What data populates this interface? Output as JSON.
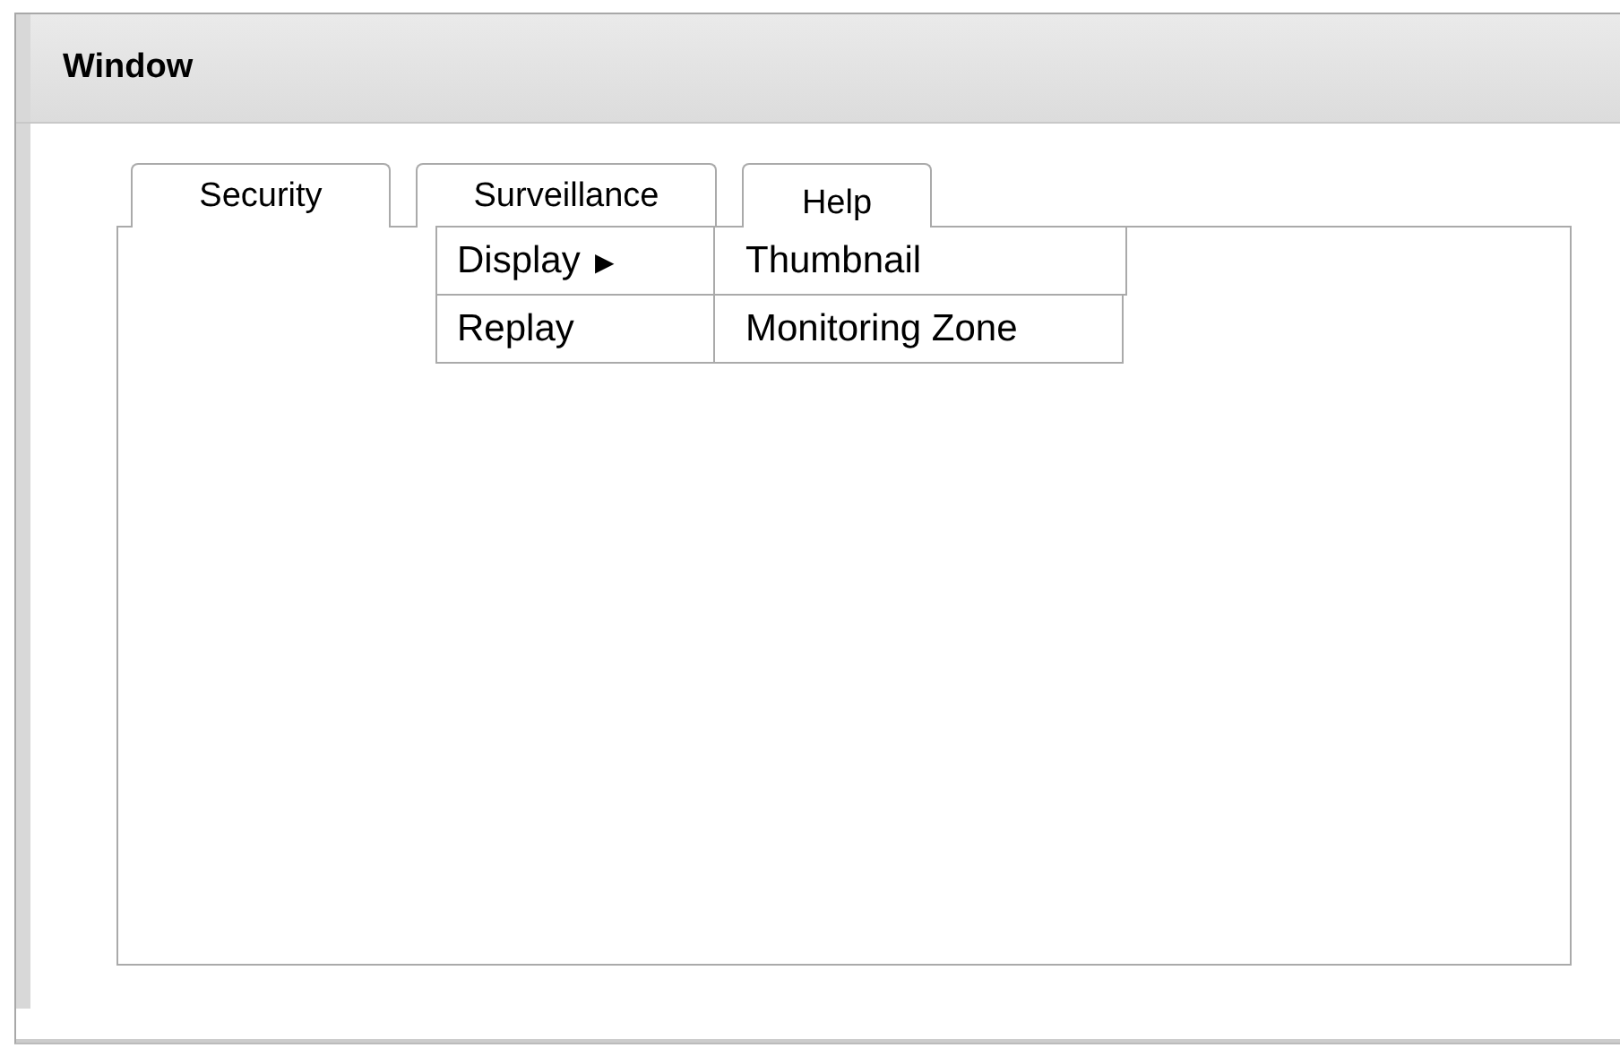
{
  "window": {
    "title": "Window"
  },
  "tabs": [
    {
      "label": "Security"
    },
    {
      "label": "Surveillance",
      "menu": [
        {
          "label": "Display",
          "arrow": "▶",
          "submenu": [
            "Thumbnail",
            "Monitoring Zone"
          ]
        },
        {
          "label": "Replay"
        }
      ]
    },
    {
      "label": "Help"
    }
  ]
}
